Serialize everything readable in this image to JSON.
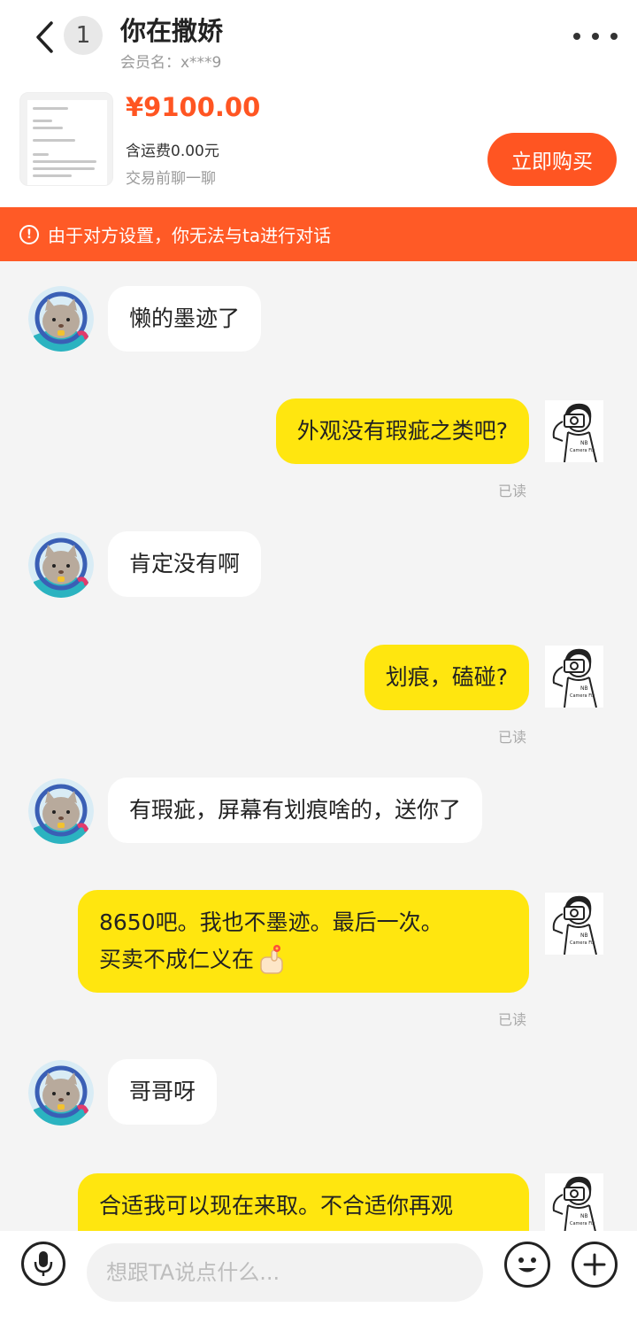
{
  "header": {
    "unread_count": "1",
    "title": "你在撒娇",
    "member": "会员名：x***9"
  },
  "product": {
    "price": "¥9100.00",
    "shipping": "含运费0.00元",
    "subtitle": "交易前聊一聊",
    "buy_label": "立即购买"
  },
  "warning": {
    "text": "由于对方设置，你无法与ta进行对话"
  },
  "messages": [
    {
      "side": "in",
      "text": "懒的墨迹了"
    },
    {
      "side": "out",
      "text": "外观没有瑕疵之类吧?",
      "status": "已读"
    },
    {
      "side": "in",
      "text": "肯定没有啊"
    },
    {
      "side": "out",
      "text": "划痕，磕碰?",
      "status": "已读"
    },
    {
      "side": "in",
      "text": "有瑕疵，屏幕有划痕啥的，送你了"
    },
    {
      "side": "out",
      "line1": "8650吧。我也不墨迹。最后一次。",
      "line2": "买卖不成仁义在",
      "status": "已读"
    },
    {
      "side": "in",
      "text": "哥哥呀"
    },
    {
      "side": "out",
      "text": "合适我可以现在来取。不合适你再观"
    }
  ],
  "input": {
    "placeholder": "想跟TA说点什么..."
  },
  "icons": {
    "back": "chevron-left-icon",
    "more": "more-dots-icon",
    "warning": "alert-circle-icon",
    "mic": "microphone-icon",
    "emoji": "smiley-icon",
    "plus": "plus-icon"
  },
  "colors": {
    "accent": "#ff5522",
    "warning_bar": "#ff5a26",
    "outgoing_bubble": "#ffe60f",
    "incoming_bubble": "#ffffff",
    "background": "#f4f4f4"
  }
}
